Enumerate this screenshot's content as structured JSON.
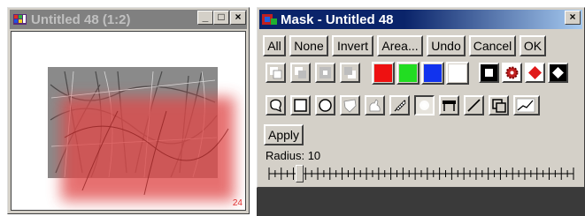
{
  "image_window": {
    "title": "Untitled 48 (1:2)",
    "buttons": [
      "_",
      "□",
      "×"
    ],
    "corner_number": "24",
    "colors": {
      "titlebar": "#808080",
      "title_text": "#c0c0c0",
      "mask_overlay": "#e04848"
    }
  },
  "mask_window": {
    "title": "Mask - Untitled 48",
    "close_button": "×",
    "command_buttons": [
      "All",
      "None",
      "Invert",
      "Area...",
      "Undo",
      "Cancel",
      "OK"
    ],
    "mode_icons": [
      "mask-mode-replace-icon",
      "mask-mode-add-icon",
      "mask-mode-subtract-icon",
      "mask-mode-intersect-icon"
    ],
    "color_swatches": [
      {
        "name": "red",
        "color": "#ee1111"
      },
      {
        "name": "green",
        "color": "#22dd22"
      },
      {
        "name": "blue",
        "color": "#1133ee"
      },
      {
        "name": "white",
        "color": "#ffffff"
      }
    ],
    "display_icons": [
      "white-square-display-icon",
      "red-gear-display-icon",
      "red-diamond-display-icon",
      "white-diamond-display-icon"
    ],
    "shape_tools": [
      "lasso-tool-icon",
      "rectangle-tool-icon",
      "ellipse-tool-icon",
      "polygon-tool-icon",
      "freehand-tool-icon",
      "feather-brush-tool-icon",
      "soft-brush-tool-icon",
      "gradient-tool-icon",
      "line-tool-icon",
      "copy-shape-tool-icon",
      "curve-tool-icon"
    ],
    "selected_tool": "soft-brush-tool-icon",
    "apply_label": "Apply",
    "radius_label": "Radius: 10",
    "radius_value": 10,
    "radius_max": 100,
    "colors": {
      "titlebar_dark": "#0a246a",
      "titlebar_light": "#a6caf0",
      "face": "#d4d0c8"
    }
  },
  "desktop": {
    "color": "#3a3a3a"
  }
}
